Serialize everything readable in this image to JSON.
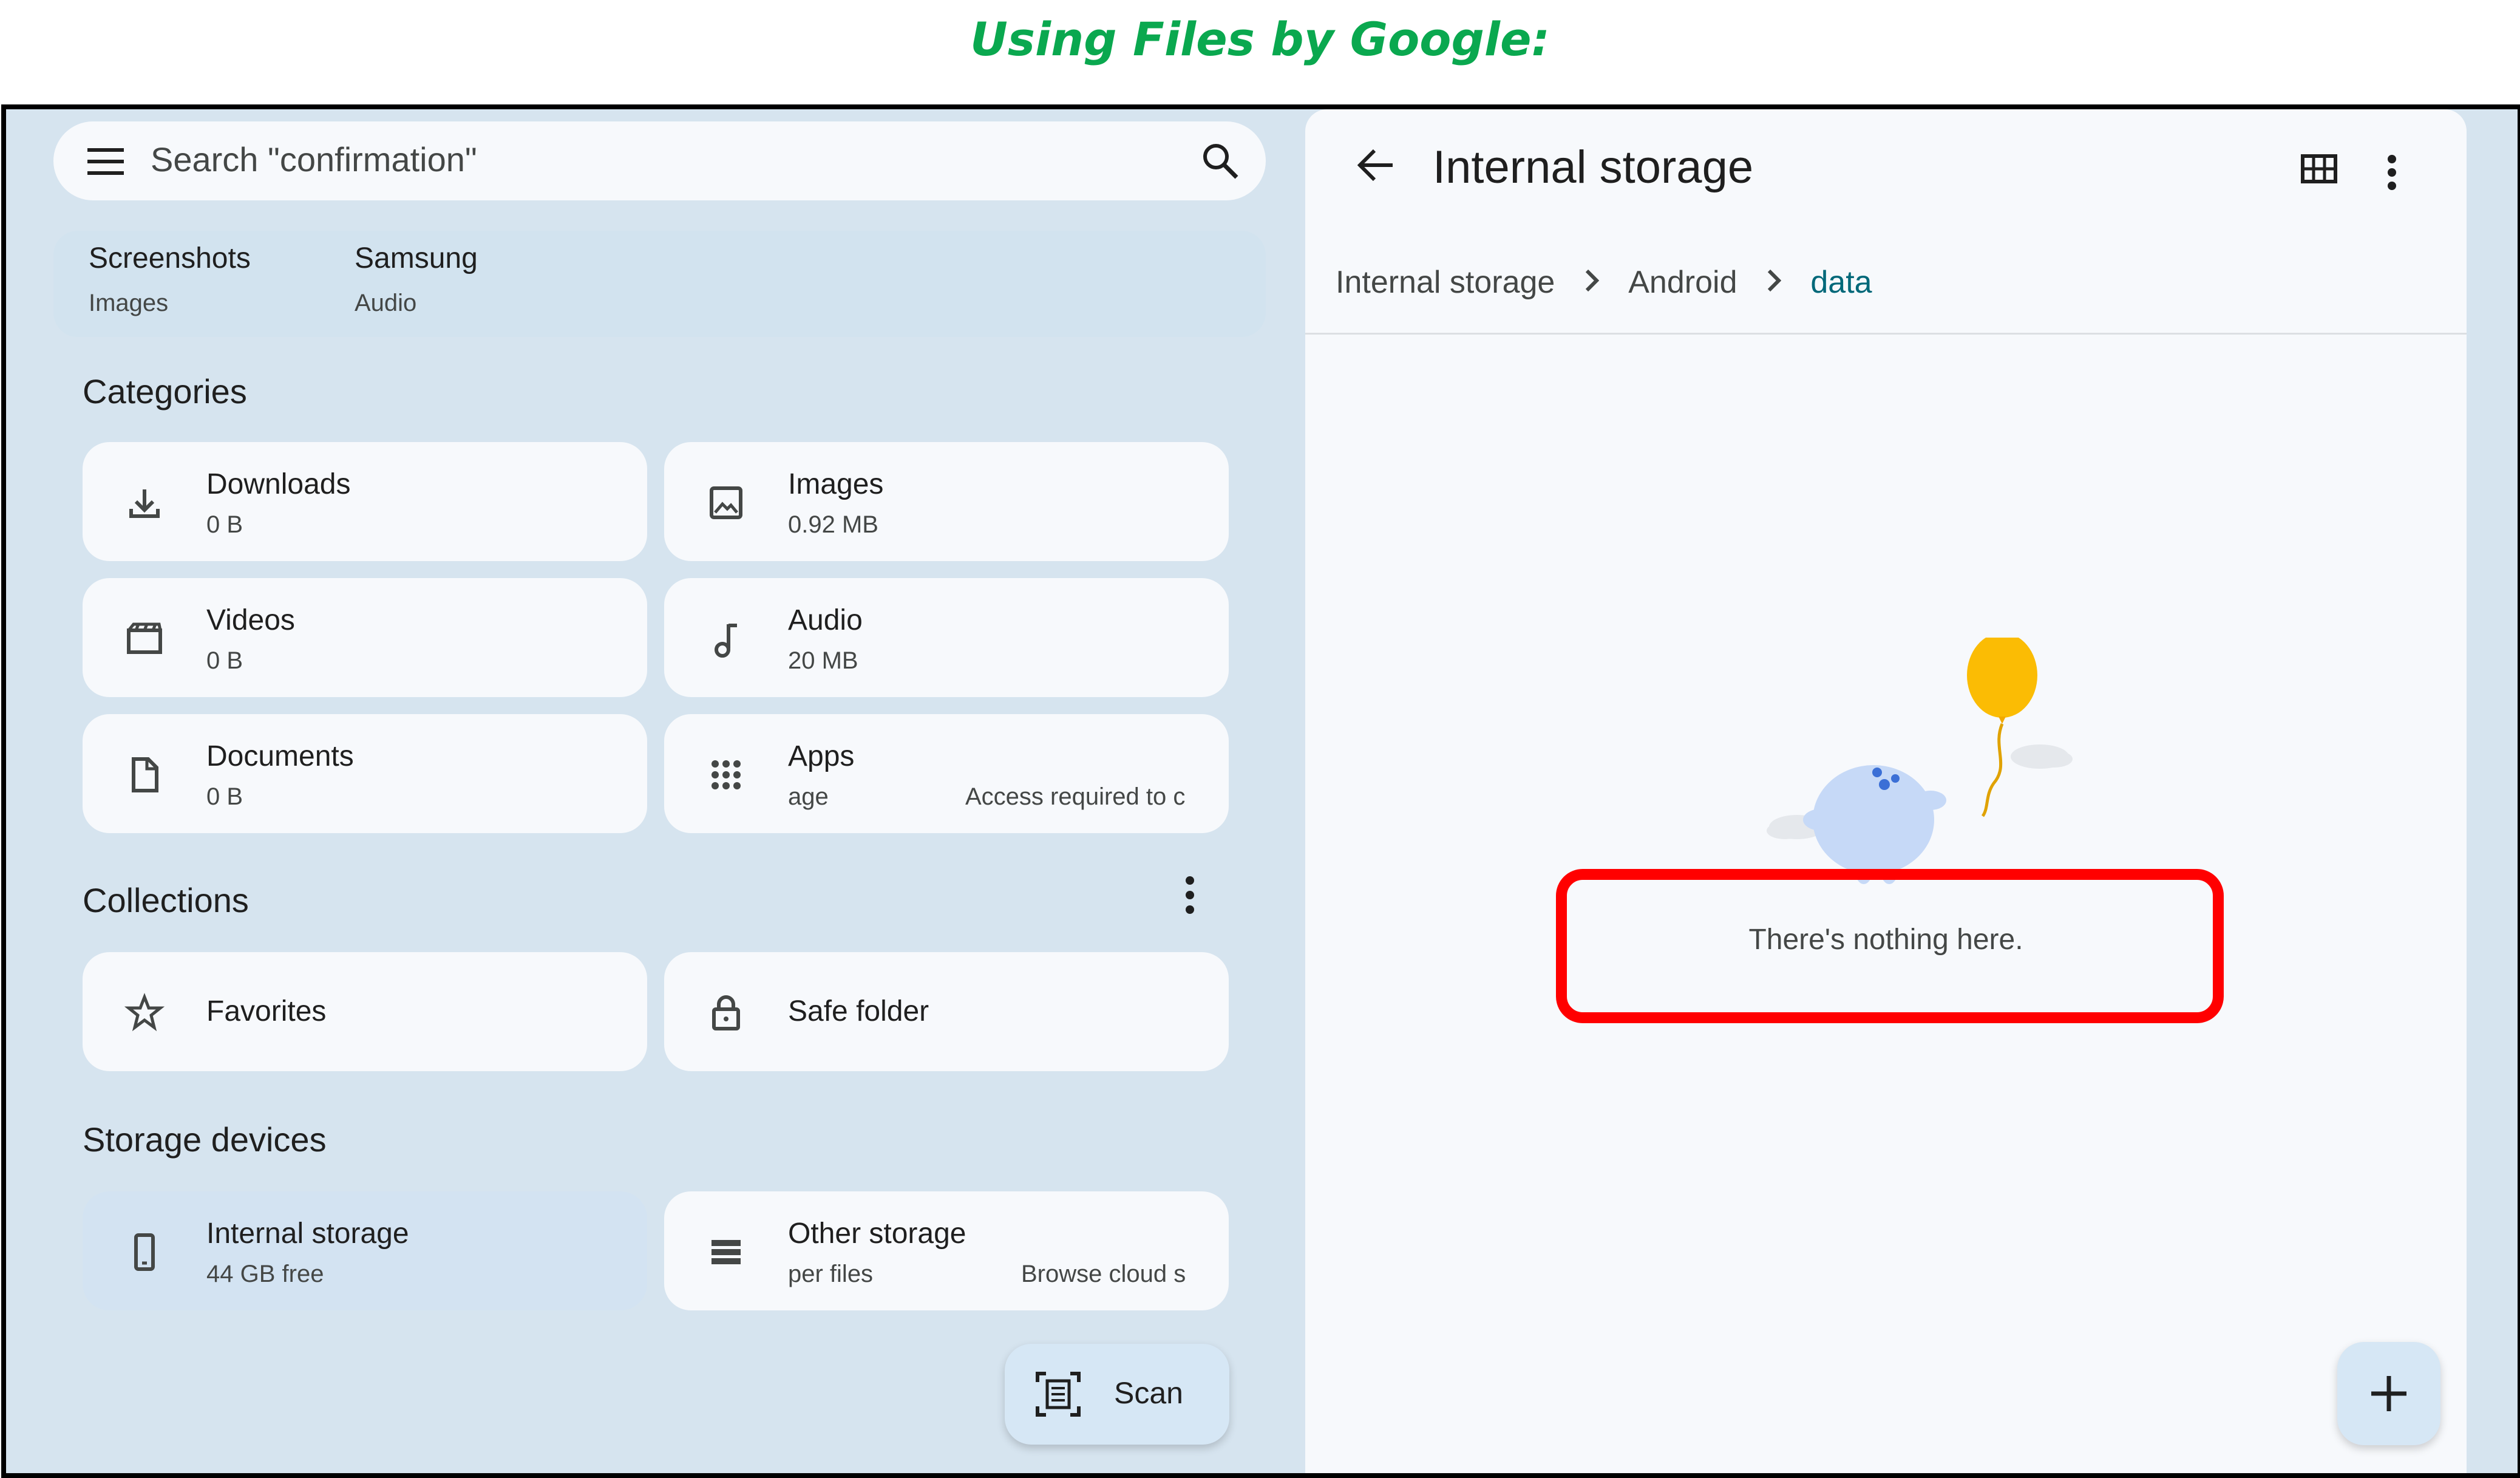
{
  "heading": "Using Files by Google:",
  "search": {
    "placeholder": "Search \"confirmation\""
  },
  "recent": [
    {
      "title": "Screenshots",
      "subtitle": "Images"
    },
    {
      "title": "Samsung",
      "subtitle": "Audio"
    }
  ],
  "categories": {
    "title": "Categories",
    "items": [
      {
        "label": "Downloads",
        "value": "0 B",
        "icon": "download-icon"
      },
      {
        "label": "Images",
        "value": "0.92 MB",
        "icon": "image-icon"
      },
      {
        "label": "Videos",
        "value": "0 B",
        "icon": "movie-icon"
      },
      {
        "label": "Audio",
        "value": "20 MB",
        "icon": "music-note-icon"
      },
      {
        "label": "Documents",
        "value": "0 B",
        "icon": "document-icon"
      },
      {
        "label": "Apps",
        "value": "age",
        "extra": "Access required to c",
        "icon": "apps-grid-icon"
      }
    ]
  },
  "collections": {
    "title": "Collections",
    "items": [
      {
        "label": "Favorites",
        "icon": "star-icon"
      },
      {
        "label": "Safe folder",
        "icon": "lock-icon"
      }
    ]
  },
  "storage": {
    "title": "Storage devices",
    "items": [
      {
        "label": "Internal storage",
        "value": "44 GB free",
        "icon": "phone-icon"
      },
      {
        "label": "Other storage",
        "value": "per files",
        "extra": "Browse cloud s",
        "icon": "storage-list-icon"
      }
    ]
  },
  "scan_label": "Scan",
  "right": {
    "title": "Internal storage",
    "breadcrumbs": [
      "Internal storage",
      "Android",
      "data"
    ],
    "empty_message": "There's nothing here."
  },
  "colors": {
    "heading": "#0aa84f",
    "highlight_box": "#ff0000",
    "balloon": "#fbbc04",
    "breadcrumb_current": "#006879"
  }
}
